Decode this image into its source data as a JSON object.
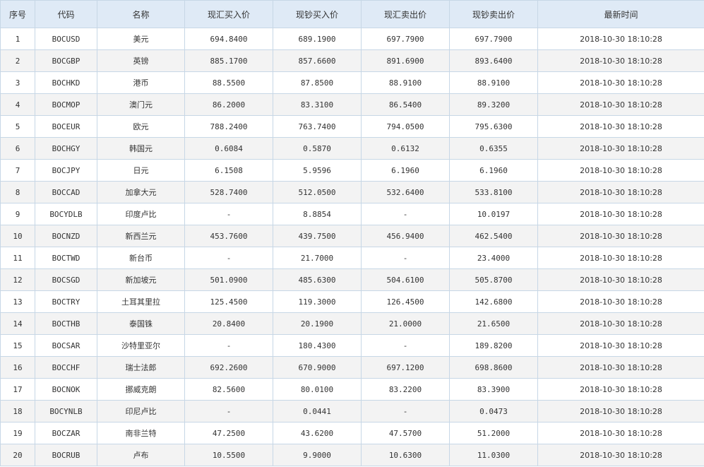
{
  "table": {
    "headers": [
      "序号",
      "代码",
      "名称",
      "现汇买入价",
      "现钞买入价",
      "现汇卖出价",
      "现钞卖出价",
      "最新时间"
    ],
    "rows": [
      [
        "1",
        "BOCUSD",
        "美元",
        "694.8400",
        "689.1900",
        "697.7900",
        "697.7900",
        "2018-10-30 18:10:28"
      ],
      [
        "2",
        "BOCGBP",
        "英镑",
        "885.1700",
        "857.6600",
        "891.6900",
        "893.6400",
        "2018-10-30 18:10:28"
      ],
      [
        "3",
        "BOCHKD",
        "港币",
        "88.5500",
        "87.8500",
        "88.9100",
        "88.9100",
        "2018-10-30 18:10:28"
      ],
      [
        "4",
        "BOCMOP",
        "澳门元",
        "86.2000",
        "83.3100",
        "86.5400",
        "89.3200",
        "2018-10-30 18:10:28"
      ],
      [
        "5",
        "BOCEUR",
        "欧元",
        "788.2400",
        "763.7400",
        "794.0500",
        "795.6300",
        "2018-10-30 18:10:28"
      ],
      [
        "6",
        "BOCHGY",
        "韩国元",
        "0.6084",
        "0.5870",
        "0.6132",
        "0.6355",
        "2018-10-30 18:10:28"
      ],
      [
        "7",
        "BOCJPY",
        "日元",
        "6.1508",
        "5.9596",
        "6.1960",
        "6.1960",
        "2018-10-30 18:10:28"
      ],
      [
        "8",
        "BOCCAD",
        "加拿大元",
        "528.7400",
        "512.0500",
        "532.6400",
        "533.8100",
        "2018-10-30 18:10:28"
      ],
      [
        "9",
        "BOCYDLB",
        "印度卢比",
        "-",
        "8.8854",
        "-",
        "10.0197",
        "2018-10-30 18:10:28"
      ],
      [
        "10",
        "BOCNZD",
        "新西兰元",
        "453.7600",
        "439.7500",
        "456.9400",
        "462.5400",
        "2018-10-30 18:10:28"
      ],
      [
        "11",
        "BOCTWD",
        "新台币",
        "-",
        "21.7000",
        "-",
        "23.4000",
        "2018-10-30 18:10:28"
      ],
      [
        "12",
        "BOCSGD",
        "新加坡元",
        "501.0900",
        "485.6300",
        "504.6100",
        "505.8700",
        "2018-10-30 18:10:28"
      ],
      [
        "13",
        "BOCTRY",
        "土耳其里拉",
        "125.4500",
        "119.3000",
        "126.4500",
        "142.6800",
        "2018-10-30 18:10:28"
      ],
      [
        "14",
        "BOCTHB",
        "泰国铢",
        "20.8400",
        "20.1900",
        "21.0000",
        "21.6500",
        "2018-10-30 18:10:28"
      ],
      [
        "15",
        "BOCSAR",
        "沙特里亚尔",
        "-",
        "180.4300",
        "-",
        "189.8200",
        "2018-10-30 18:10:28"
      ],
      [
        "16",
        "BOCCHF",
        "瑞士法郎",
        "692.2600",
        "670.9000",
        "697.1200",
        "698.8600",
        "2018-10-30 18:10:28"
      ],
      [
        "17",
        "BOCNOK",
        "挪威克朗",
        "82.5600",
        "80.0100",
        "83.2200",
        "83.3900",
        "2018-10-30 18:10:28"
      ],
      [
        "18",
        "BOCYNLB",
        "印尼卢比",
        "-",
        "0.0441",
        "-",
        "0.0473",
        "2018-10-30 18:10:28"
      ],
      [
        "19",
        "BOCZAR",
        "南非兰特",
        "47.2500",
        "43.6200",
        "47.5700",
        "51.2000",
        "2018-10-30 18:10:28"
      ],
      [
        "20",
        "BOCRUB",
        "卢布",
        "10.5500",
        "9.9000",
        "10.6300",
        "11.0300",
        "2018-10-30 18:10:28"
      ]
    ]
  }
}
